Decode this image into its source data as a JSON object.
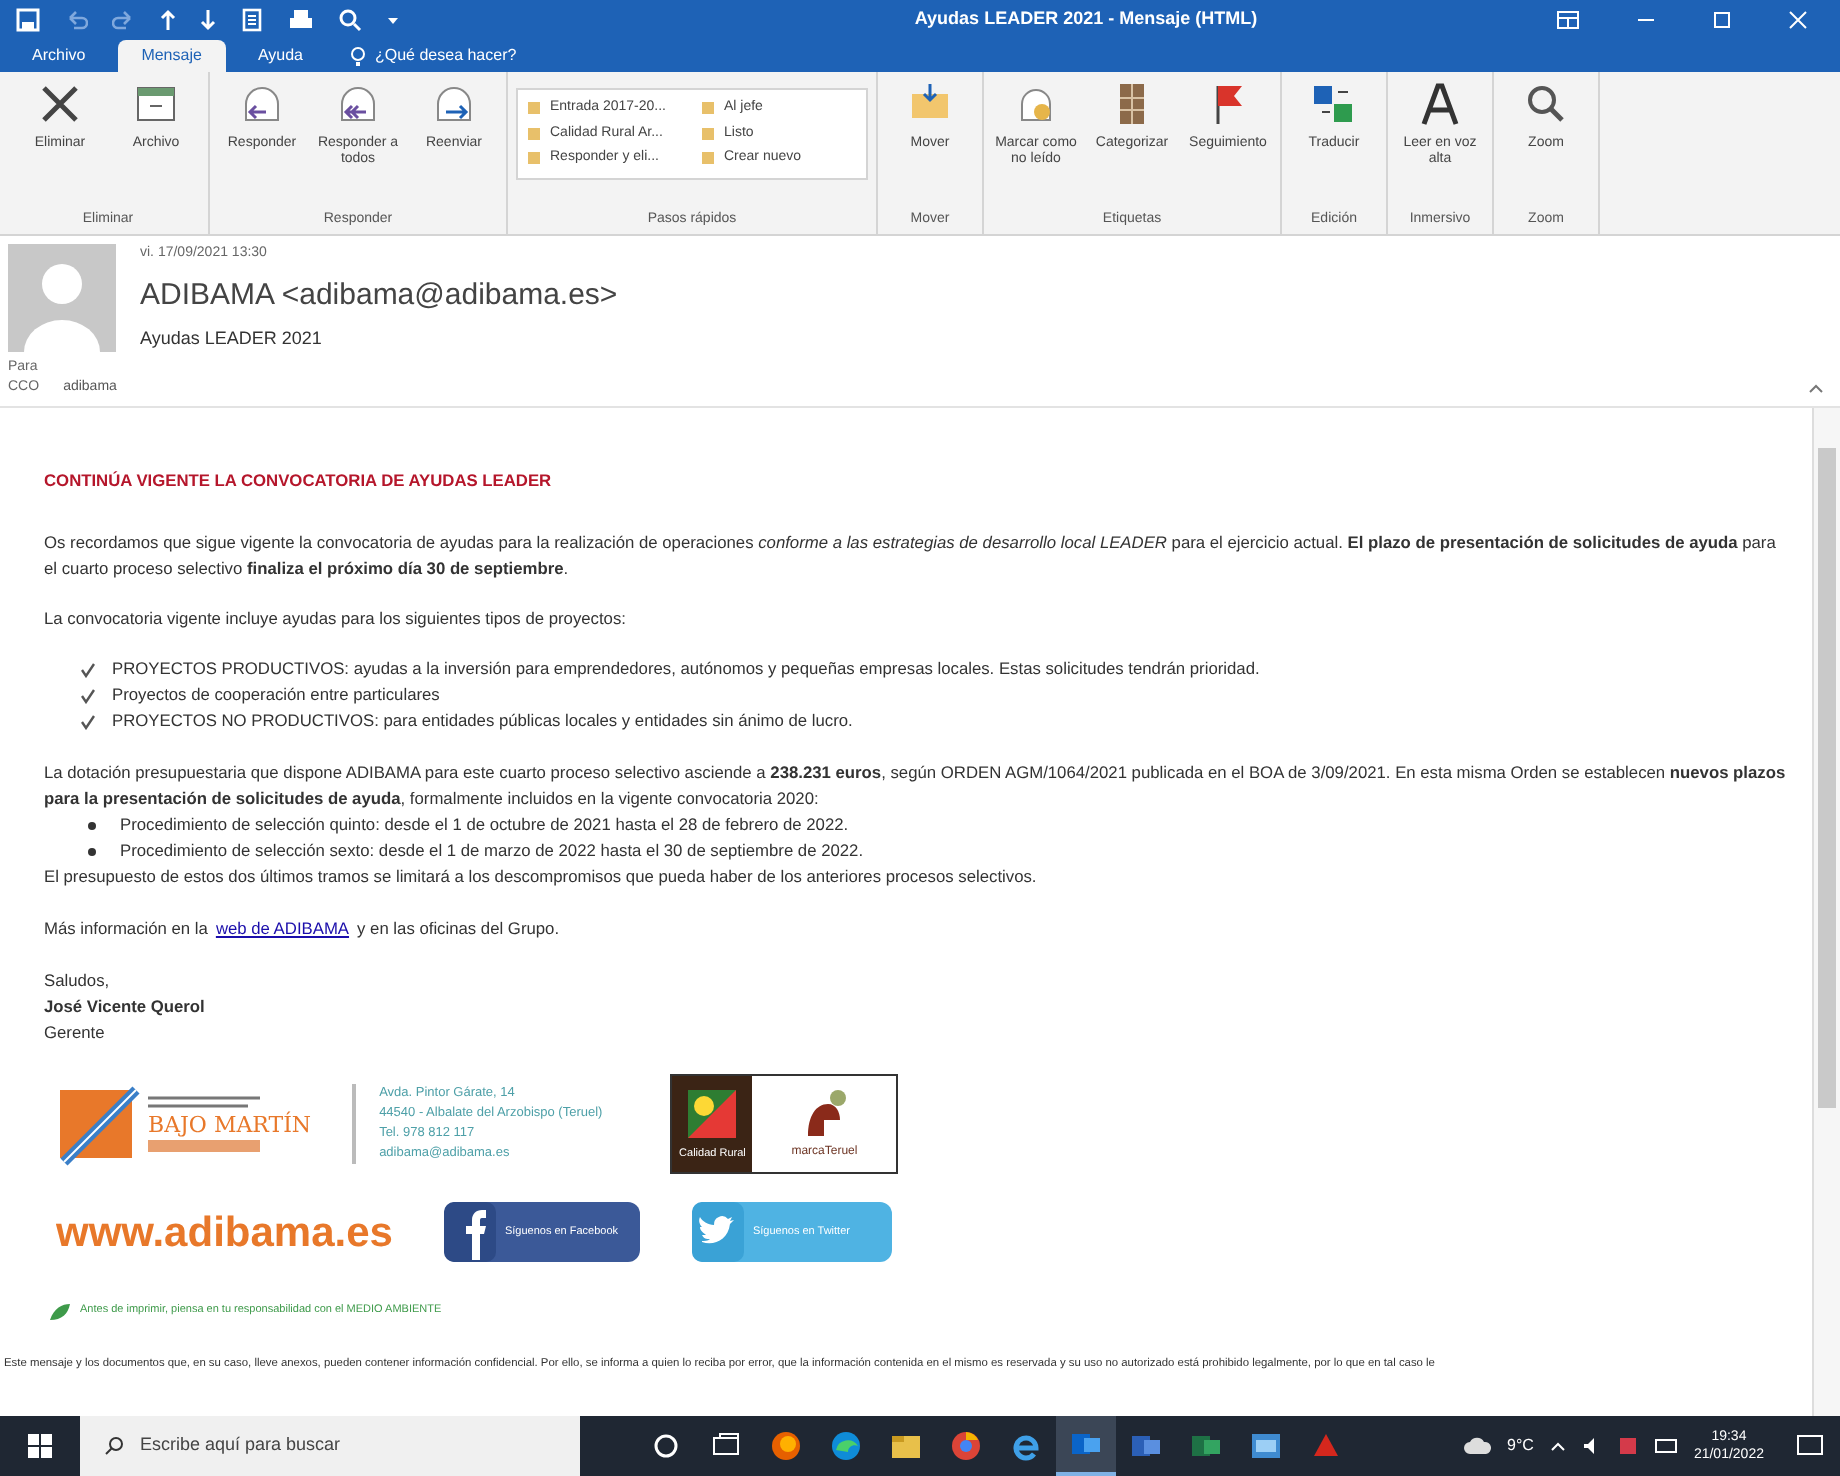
{
  "window": {
    "title": "Ayudas LEADER 2021 - Mensaje (HTML)"
  },
  "tabs": [
    {
      "label": "Archivo",
      "selected": false
    },
    {
      "label": "Mensaje",
      "selected": true
    },
    {
      "label": "Ayuda",
      "selected": false
    }
  ],
  "tell_me": {
    "placeholder": "¿Qué desea hacer?"
  },
  "ribbon": [
    {
      "label": "Eliminar",
      "buttons": [
        "Eliminar",
        "Archivo"
      ]
    },
    {
      "label": "Responder",
      "buttons": [
        "Responder",
        "Responder a todos",
        "Reenviar"
      ]
    },
    {
      "label": "Pasos rápidos",
      "quick_steps": [
        "Entrada 2017-20...",
        "Al jefe",
        "Calidad Rural Ar...",
        "Listo",
        "Responder y eli...",
        "Crear nuevo"
      ]
    },
    {
      "label": "Mover",
      "buttons": [
        "Mover"
      ]
    },
    {
      "label": "Etiquetas",
      "buttons": [
        "Marcar como no leído",
        "Categorizar",
        "Seguimiento"
      ]
    },
    {
      "label": "Edición",
      "buttons": [
        "Traducir"
      ]
    },
    {
      "label": "Inmersivo",
      "buttons": [
        "Leer en voz alta"
      ]
    },
    {
      "label": "Zoom",
      "buttons": [
        "Zoom"
      ]
    }
  ],
  "header": {
    "date": "vi. 17/09/2021 13:30",
    "sender": "ADIBAMA <adibama@adibama.es>",
    "subject": "Ayudas LEADER 2021",
    "to_label": "Para",
    "bcc_label": "CCO",
    "bcc": "adibama"
  },
  "body": {
    "heading": "CONTINÚA VIGENTE LA CONVOCATORIA DE AYUDAS LEADER",
    "intro": "Os recordamos que sigue vigente la convocatoria de ayudas para la realización de operaciones *conforme a las estrategias de desarrollo local LEADER* para el ejercicio actual. **El plazo de presentación de solicitudes de ayuda** para el cuarto proceso selectivo **finaliza el próximo día 30 de septiembre**.",
    "list_intro": "La convocatoria vigente incluye ayudas para los siguientes tipos de proyectos:",
    "project_types": [
      "PROYECTOS PRODUCTIVOS: ayudas a la inversión para emprendedores, autónomos y pequeñas empresas locales. Estas solicitudes tendrán prioridad.",
      "Proyectos de cooperación entre particulares",
      "PROYECTOS NO PRODUCTIVOS: para entidades públicas locales y entidades sin ánimo de lucro."
    ],
    "budget": "La dotación presupuestaria que dispone ADIBAMA para este cuarto proceso selectivo asciende a **238.231 euros**, según ORDEN AGM/1064/2021 publicada en el BOA de 3/09/2021. En esta misma Orden se establecen **nuevos plazos para la presentación de solicitudes de ayuda**, formalmente incluidos en la vigente convocatoria 2020:",
    "periods": [
      "Procedimiento de selección quinto: desde el 1 de octubre de 2021 hasta el 28 de febrero de 2022.",
      "Procedimiento de selección sexto: desde el 1 de marzo de 2022 hasta el 30 de septiembre de 2022."
    ],
    "budget_note": "El presupuesto de estos dos últimos tramos se limitará a los descompromisos que pueda haber de los anteriores procesos selectivos.",
    "more_before": "Más información en la",
    "more_link": "web de ADIBAMA",
    "more_after": "y en las oficinas del Grupo.",
    "greeting": "Saludos,",
    "signer": "José Vicente Querol",
    "role": "Gerente"
  },
  "signature": {
    "logo_text": "BAJO MARTÍN",
    "contact": [
      "Avda. Pintor Gárate, 14",
      "44540 - Albalate del Arzobispo (Teruel)",
      "Tel. 978 812 117",
      "adibama@adibama.es"
    ],
    "badge_left": "Calidad Rural",
    "badge_right": "marcaTeruel",
    "website": "www.adibama.es",
    "facebook": "Síguenos en Facebook",
    "twitter": "Síguenos en Twitter",
    "eco_note": "Antes de imprimir, piensa en tu responsabilidad con el MEDIO AMBIENTE",
    "disclaimer": "Este mensaje y los documentos que, en su caso, lleve anexos, pueden contener información confidencial. Por ello, se informa a quien lo reciba por error, que la información contenida en el mismo es reservada y su uso no autorizado está prohibido legalmente, por lo que en tal caso le"
  },
  "taskbar": {
    "search_placeholder": "Escribe aquí para buscar",
    "weather": "9°C",
    "time": "19:34",
    "date": "21/01/2022"
  }
}
